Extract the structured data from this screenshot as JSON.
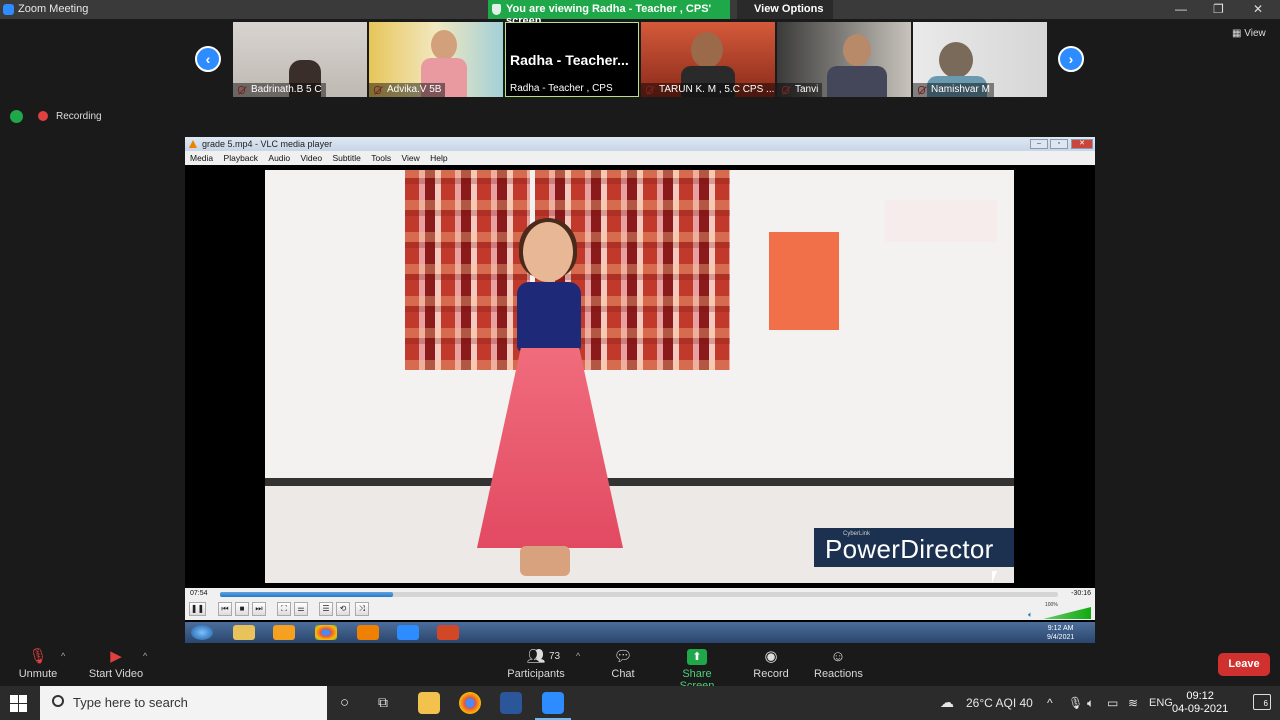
{
  "window": {
    "title": "Zoom Meeting",
    "share_banner": "You are viewing Radha - Teacher , CPS' screen",
    "view_options": "View Options",
    "controls": [
      "—",
      "❐",
      "✕"
    ]
  },
  "participants_strip": [
    {
      "name": "Badrinath.B 5 C",
      "muted": true
    },
    {
      "name": "Advika.V 5B",
      "muted": true
    },
    {
      "name": "Radha - Teacher , CPS",
      "display_name": "Radha  - Teacher...",
      "muted": false,
      "active_speaker": true
    },
    {
      "name": "TARUN K. M , 5.C CPS ...",
      "muted": true
    },
    {
      "name": "Tanvi",
      "muted": true
    },
    {
      "name": "Namishvar M",
      "muted": true
    }
  ],
  "view_button": "View",
  "recording_label": "Recording",
  "vlc": {
    "title": "grade 5.mp4 - VLC media player",
    "menu": [
      "Media",
      "Playback",
      "Audio",
      "Video",
      "Subtitle",
      "Tools",
      "View",
      "Help"
    ],
    "time_elapsed": "07:54",
    "time_remaining": "-30:16",
    "progress": 0.207,
    "volume": "100%",
    "watermark_small": "CyberLink",
    "watermark": "PowerDirector",
    "inner_clock_time": "9:12 AM",
    "inner_clock_date": "9/4/2021"
  },
  "toolbar": {
    "unmute": "Unmute",
    "start_video": "Start Video",
    "participants": "Participants",
    "participants_count": "73",
    "chat": "Chat",
    "share_screen": "Share Screen",
    "record": "Record",
    "reactions": "Reactions",
    "leave": "Leave"
  },
  "taskbar": {
    "search_placeholder": "Type here to search",
    "weather": "26°C  AQI 40",
    "language": "ENG",
    "time": "09:12",
    "date": "04-09-2021",
    "notifications": "6"
  },
  "colors": {
    "zoom_blue": "#2d8cff",
    "share_green": "#1fa84a",
    "leave_red": "#d0302e",
    "vlc_orange": "#f08000"
  }
}
